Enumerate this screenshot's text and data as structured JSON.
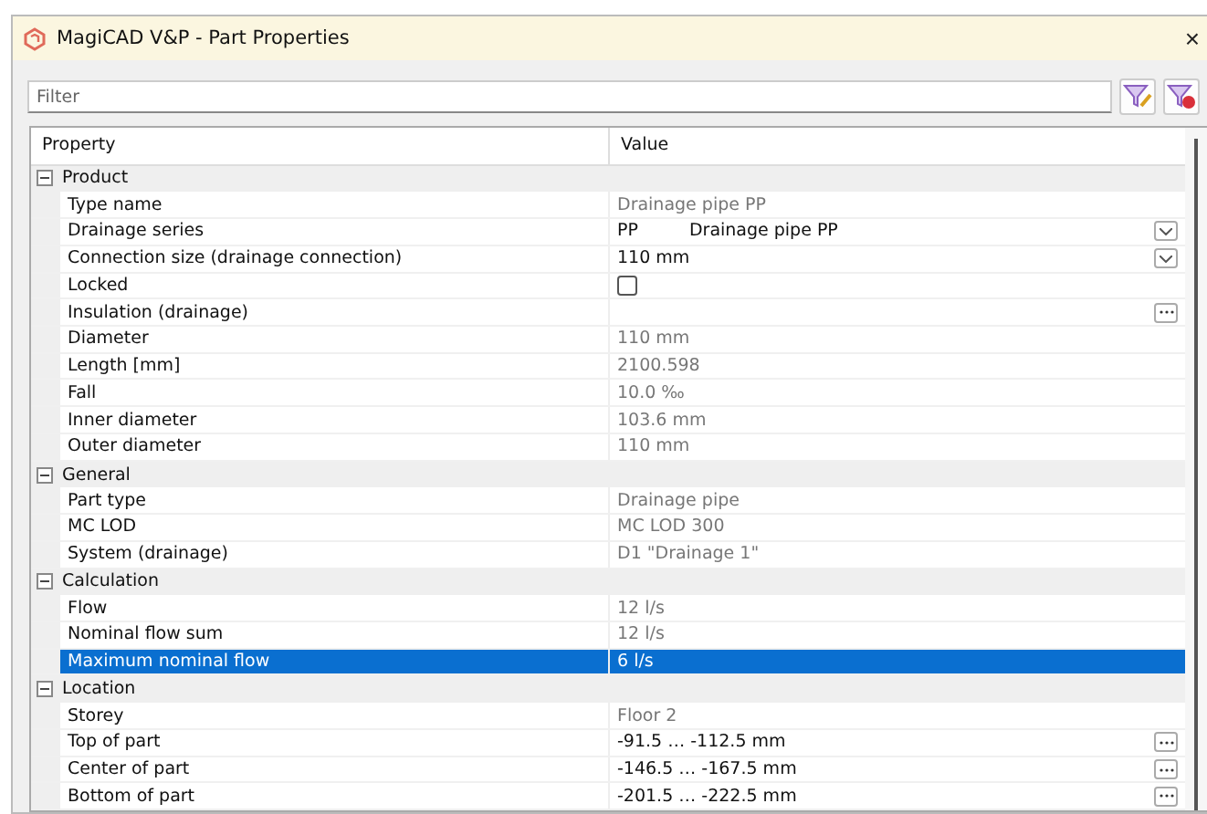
{
  "window": {
    "title": "MagiCAD V&P - Part Properties",
    "close": "×"
  },
  "filter": {
    "placeholder": "Filter"
  },
  "table": {
    "columns": [
      "Property",
      "Value"
    ],
    "rows": [
      {
        "kind": "group",
        "label": "Product",
        "expanded": true
      },
      {
        "kind": "text",
        "name": "Type name",
        "value": "Drainage pipe PP",
        "readonly": true,
        "selected": false
      },
      {
        "kind": "dropdown",
        "name": "Drainage series",
        "value": "PP",
        "value_2": "Drainage pipe PP",
        "readonly": false,
        "selected": false
      },
      {
        "kind": "dropdown",
        "name": "Connection size (drainage connection)",
        "value": "110 mm",
        "readonly": false,
        "selected": false
      },
      {
        "kind": "checkbox",
        "name": "Locked",
        "checked": false,
        "selected": false
      },
      {
        "kind": "ellipsis",
        "name": "Insulation (drainage)",
        "selected": false
      },
      {
        "kind": "text",
        "name": "Diameter",
        "value": "110 mm",
        "readonly": true,
        "selected": false
      },
      {
        "kind": "text",
        "name": "Length [mm]",
        "value": "2100.598",
        "readonly": true,
        "selected": false
      },
      {
        "kind": "text",
        "name": "Fall",
        "value": "10.0 ‰",
        "readonly": true,
        "selected": false
      },
      {
        "kind": "text",
        "name": "Inner diameter",
        "value": "103.6 mm",
        "readonly": true,
        "selected": false
      },
      {
        "kind": "text",
        "name": "Outer diameter",
        "value": "110 mm",
        "readonly": true,
        "selected": false
      },
      {
        "kind": "group",
        "label": "General",
        "expanded": true
      },
      {
        "kind": "text",
        "name": "Part type",
        "value": "Drainage pipe",
        "readonly": true,
        "selected": false
      },
      {
        "kind": "text",
        "name": "MC LOD",
        "value": "MC LOD 300",
        "readonly": true,
        "selected": false
      },
      {
        "kind": "text",
        "name": "System (drainage)",
        "value": "D1 \"Drainage 1\"",
        "readonly": true,
        "selected": false
      },
      {
        "kind": "group",
        "label": "Calculation",
        "expanded": true
      },
      {
        "kind": "text",
        "name": "Flow",
        "value": "12 l/s",
        "readonly": true,
        "selected": false
      },
      {
        "kind": "text",
        "name": "Nominal flow sum",
        "value": "12 l/s",
        "readonly": true,
        "selected": false
      },
      {
        "kind": "text",
        "name": "Maximum nominal flow",
        "value": "6 l/s",
        "readonly": true,
        "selected": true
      },
      {
        "kind": "group",
        "label": "Location",
        "expanded": true
      },
      {
        "kind": "text",
        "name": "Storey",
        "value": "Floor 2",
        "readonly": true,
        "selected": false
      },
      {
        "kind": "ellipsis",
        "name": "Top of part",
        "value": "-91.5 … -112.5 mm",
        "readonly": false,
        "selected": false
      },
      {
        "kind": "ellipsis",
        "name": "Center of part",
        "value": "-146.5 … -167.5 mm",
        "readonly": false,
        "selected": false
      },
      {
        "kind": "ellipsis",
        "name": "Bottom of part",
        "value": "-201.5 … -222.5 mm",
        "readonly": false,
        "selected": false
      }
    ]
  }
}
